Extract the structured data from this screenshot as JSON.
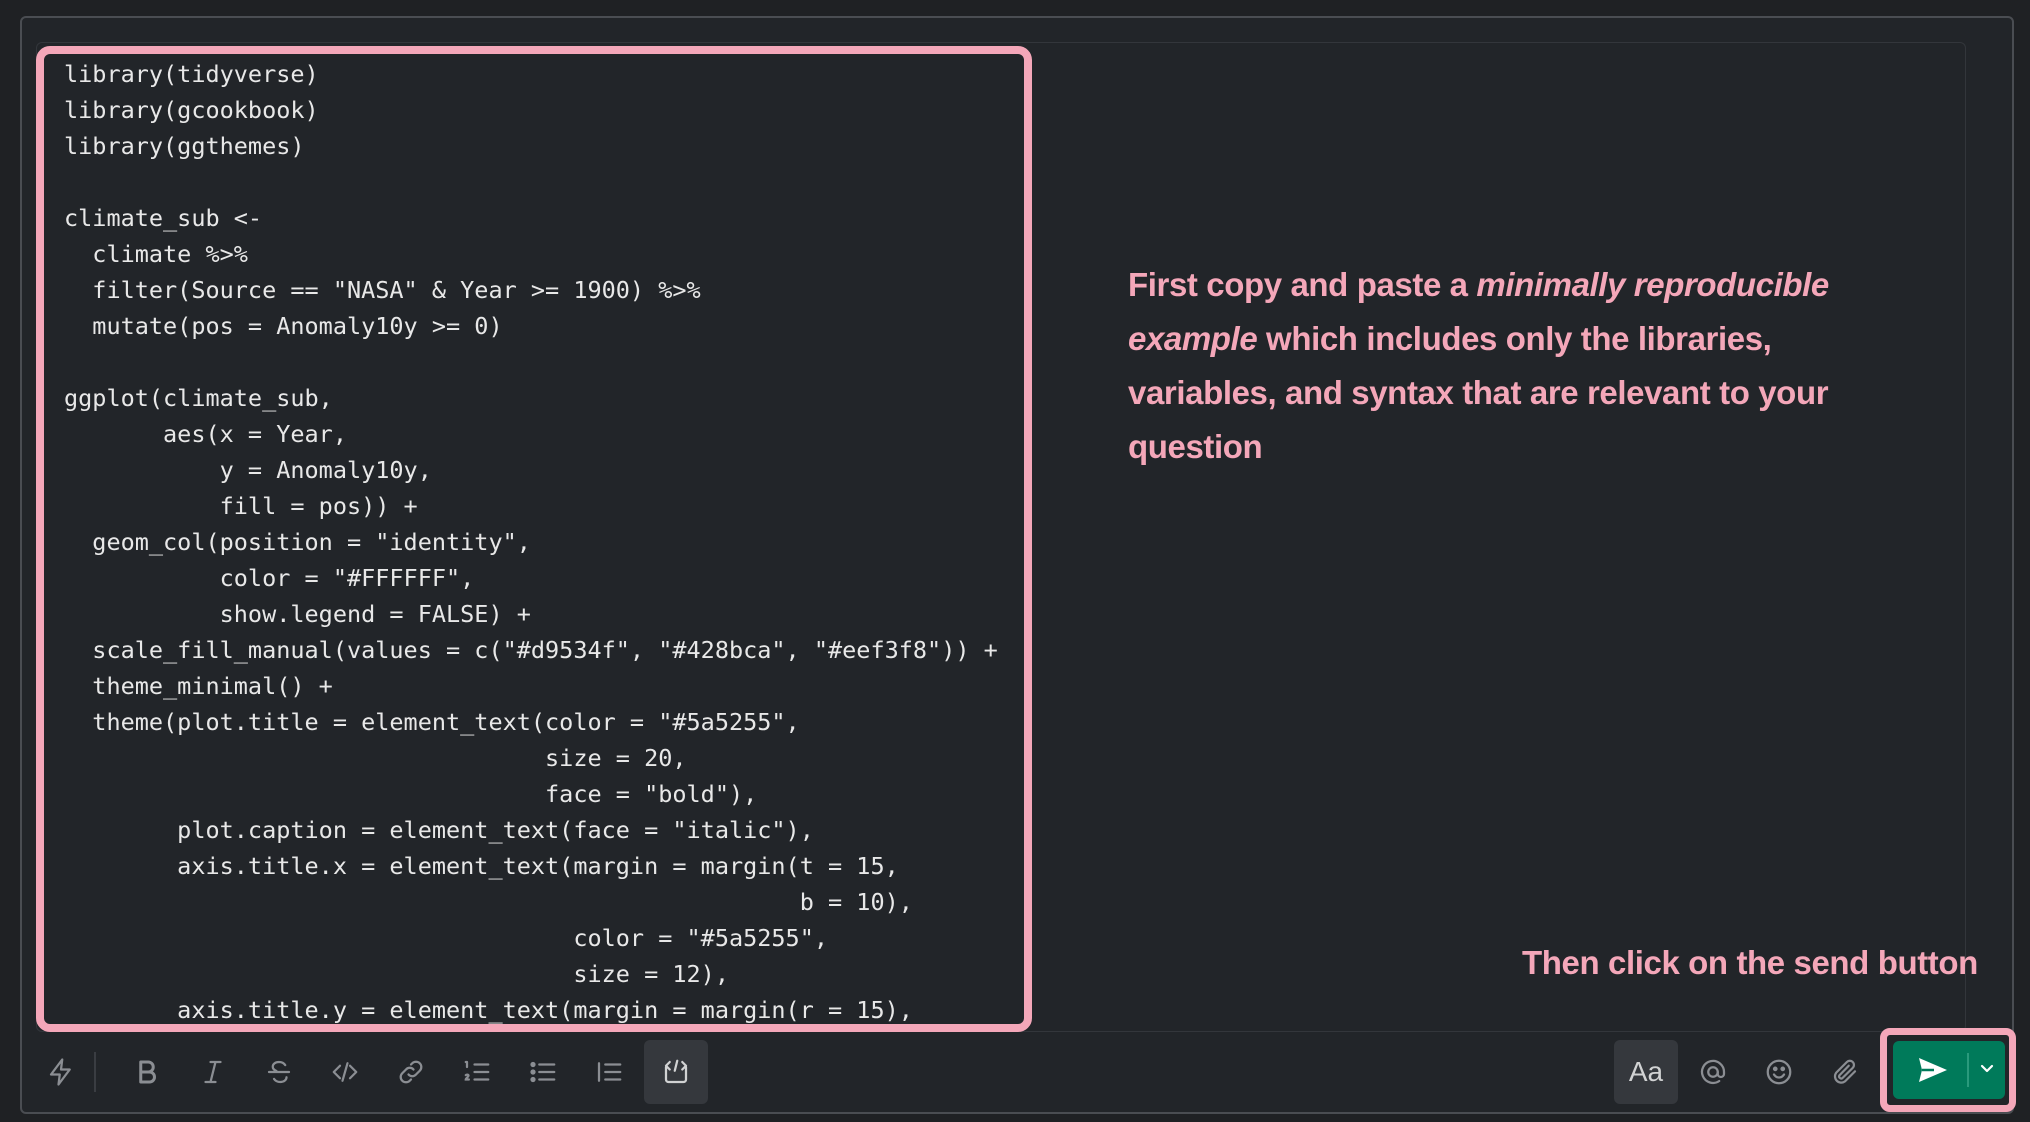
{
  "editor": {
    "code_lines": [
      "library(tidyverse)",
      "library(gcookbook)",
      "library(ggthemes)",
      "",
      "climate_sub <-",
      "  climate %>%",
      "  filter(Source == \"NASA\" & Year >= 1900) %>%",
      "  mutate(pos = Anomaly10y >= 0)",
      "",
      "ggplot(climate_sub,",
      "       aes(x = Year,",
      "           y = Anomaly10y,",
      "           fill = pos)) +",
      "  geom_col(position = \"identity\",",
      "           color = \"#FFFFFF\",",
      "           show.legend = FALSE) +",
      "  scale_fill_manual(values = c(\"#d9534f\", \"#428bca\", \"#eef3f8\")) +",
      "  theme_minimal() +",
      "  theme(plot.title = element_text(color = \"#5a5255\",",
      "                                  size = 20,",
      "                                  face = \"bold\"),",
      "        plot.caption = element_text(face = \"italic\"),",
      "        axis.title.x = element_text(margin = margin(t = 15,",
      "                                                    b = 10),",
      "                                    color = \"#5a5255\",",
      "                                    size = 12),",
      "        axis.title.y = element_text(margin = margin(r = 15),"
    ]
  },
  "annotations": {
    "first_pre": "First copy and paste a ",
    "first_em": "minimally reproducible example",
    "first_post": " which includes only the libraries, variables, and syntax that are relevant to your question",
    "second": "Then click on the send button"
  },
  "toolbar": {
    "left_icons": [
      "shortcuts-icon",
      "bold-icon",
      "italic-icon",
      "strikethrough-icon",
      "code-icon",
      "link-icon",
      "ordered-list-icon",
      "bulleted-list-icon",
      "blockquote-icon",
      "code-block-icon"
    ],
    "right_icons": [
      "formatting-icon",
      "mention-icon",
      "emoji-icon",
      "attach-icon"
    ],
    "formatting_label": "Aa"
  },
  "colors": {
    "highlight": "#f4a7b9",
    "send_button": "#007a5a",
    "background": "#222529"
  }
}
